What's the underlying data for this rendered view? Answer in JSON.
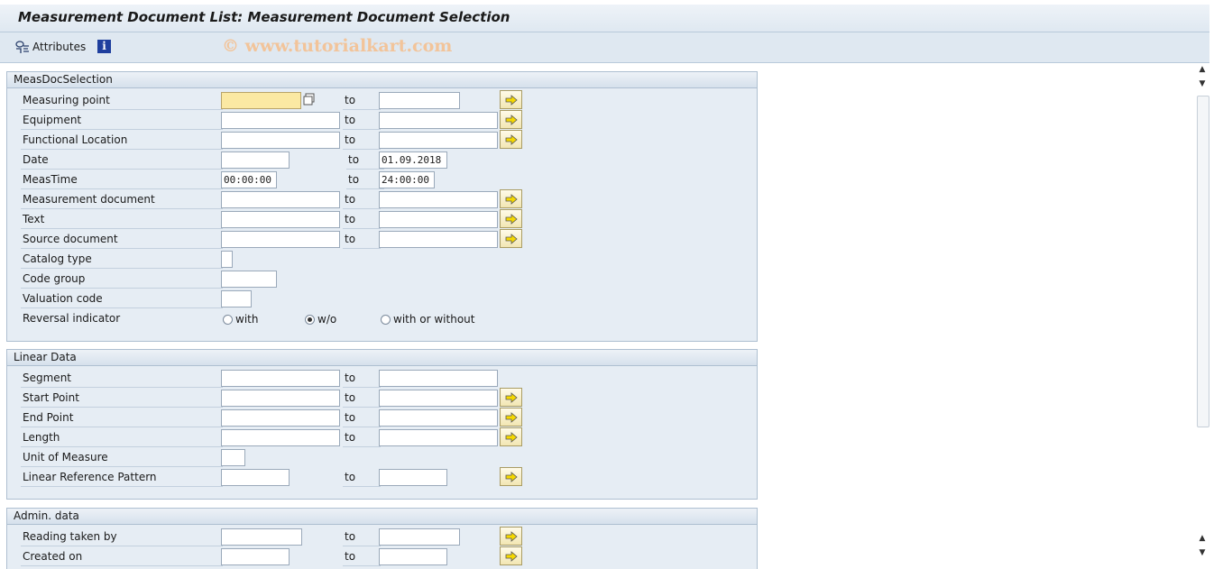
{
  "title": "Measurement Document List: Measurement Document Selection",
  "toolbar": {
    "attributes_label": "Attributes",
    "info_icon": "info-icon",
    "watermark": "© www.tutorialkart.com"
  },
  "colors": {
    "header_bg": "#dfe8f1",
    "group_bg": "#e6edf4",
    "focus_field": "#fbe9a3",
    "watermark": "#f2c49a"
  },
  "to_label": "to",
  "meas_doc": {
    "title": "MeasDocSelection",
    "rows": [
      {
        "label": "Measuring point",
        "from": "",
        "to": "",
        "to_label": "to",
        "multi": true
      },
      {
        "label": "Equipment",
        "from": "",
        "to": "",
        "to_label": "to",
        "multi": true
      },
      {
        "label": "Functional Location",
        "from": "",
        "to": "",
        "to_label": "to",
        "multi": true
      },
      {
        "label": "Date",
        "from": "",
        "to": "01.09.2018",
        "to_label": "to",
        "multi": false
      },
      {
        "label": "MeasTime",
        "from": "00:00:00",
        "to": "24:00:00",
        "to_label": "to",
        "multi": false
      },
      {
        "label": "Measurement document",
        "from": "",
        "to": "",
        "to_label": "to",
        "multi": true
      },
      {
        "label": "Text",
        "from": "",
        "to": "",
        "to_label": "to",
        "multi": true
      },
      {
        "label": "Source document",
        "from": "",
        "to": "",
        "to_label": "to",
        "multi": true
      },
      {
        "label": "Catalog type",
        "from": ""
      },
      {
        "label": "Code group",
        "from": ""
      },
      {
        "label": "Valuation code",
        "from": ""
      }
    ],
    "reversal": {
      "label": "Reversal indicator",
      "options": [
        {
          "label": "with",
          "selected": false
        },
        {
          "label": "w/o",
          "selected": true
        },
        {
          "label": "with or without",
          "selected": false
        }
      ]
    }
  },
  "linear": {
    "title": "Linear Data",
    "rows": [
      {
        "label": "Segment",
        "to_label": "to",
        "multi": false
      },
      {
        "label": "Start Point",
        "to_label": "to",
        "multi": true
      },
      {
        "label": "End Point",
        "to_label": "to",
        "multi": true
      },
      {
        "label": "Length",
        "to_label": "to",
        "multi": true
      },
      {
        "label": "Unit of Measure"
      },
      {
        "label": "Linear Reference Pattern",
        "to_label": "to",
        "multi": true
      }
    ]
  },
  "admin": {
    "title": "Admin. data",
    "rows": [
      {
        "label": "Reading taken by",
        "to_label": "to",
        "multi": true
      },
      {
        "label": "Created on",
        "to_label": "to",
        "multi": true
      }
    ]
  }
}
